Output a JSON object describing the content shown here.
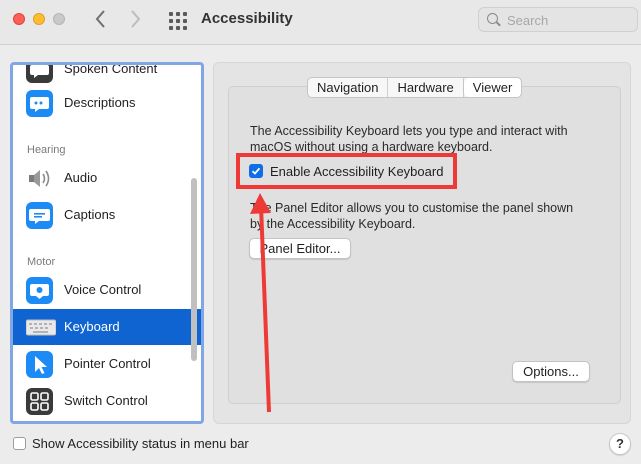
{
  "window": {
    "title": "Accessibility",
    "search_placeholder": "Search"
  },
  "sidebar": {
    "top_items": [
      {
        "label": "Spoken Content",
        "icon": "spoken-content-icon"
      },
      {
        "label": "Descriptions",
        "icon": "descriptions-icon"
      }
    ],
    "sections": [
      {
        "header": "Hearing",
        "items": [
          {
            "label": "Audio",
            "icon": "speaker-icon"
          },
          {
            "label": "Captions",
            "icon": "captions-icon"
          }
        ]
      },
      {
        "header": "Motor",
        "items": [
          {
            "label": "Voice Control",
            "icon": "voice-control-icon"
          },
          {
            "label": "Keyboard",
            "icon": "keyboard-icon",
            "selected": true
          },
          {
            "label": "Pointer Control",
            "icon": "pointer-icon"
          },
          {
            "label": "Switch Control",
            "icon": "switch-control-icon"
          }
        ]
      }
    ]
  },
  "tabs": [
    {
      "label": "Navigation",
      "active": false
    },
    {
      "label": "Hardware",
      "active": false
    },
    {
      "label": "Viewer",
      "active": true
    }
  ],
  "content": {
    "description1": "The Accessibility Keyboard lets you type and interact with macOS without using a hardware keyboard.",
    "checkbox_label": "Enable Accessibility Keyboard",
    "checkbox_checked": true,
    "description2": "The Panel Editor allows you to customise the panel shown by the Accessibility Keyboard.",
    "panel_editor_button": "Panel Editor...",
    "options_button": "Options..."
  },
  "footer": {
    "status_checkbox_label": "Show Accessibility status in menu bar",
    "status_checkbox_checked": false,
    "help_label": "?"
  },
  "colors": {
    "accent": "#0f64d2",
    "highlight_box": "#ee3a36",
    "annotation_arrow": "#ee3a36"
  }
}
